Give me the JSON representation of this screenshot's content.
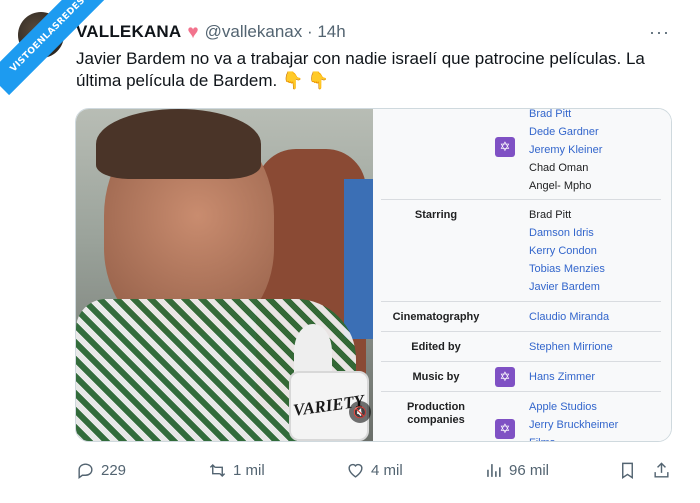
{
  "watermark": "VISTOENLASREDES",
  "tweet": {
    "author_name": "VALLEKANA",
    "handle_time": "@vallekanax · 14h",
    "more_icon": "more-dots-icon",
    "text_line1": "Javier Bardem no va a trabajar con nadie israelí que patrocine películas. La",
    "text_line2": "última película de Bardem. ",
    "emoji": "👇 👇"
  },
  "photo": {
    "mic_brand": "VARIETY",
    "mute_icon": "🔇"
  },
  "infobox": {
    "star_badge": "✡",
    "producers": [
      "Brad Pitt",
      "Dede Gardner",
      "Jeremy Kleiner",
      "Chad Oman",
      "Angel- Mpho"
    ],
    "starring_label": "Starring",
    "starring": [
      "Brad Pitt",
      "Damson Idris",
      "Kerry Condon",
      "Tobias Menzies",
      "Javier Bardem"
    ],
    "cinematography_label": "Cinematography",
    "cinematography": "Claudio Miranda",
    "edited_label": "Edited by",
    "edited": "Stephen Mirrione",
    "music_label": "Music by",
    "music": "Hans Zimmer",
    "production_label_1": "Production",
    "production_label_2": "companies",
    "production": [
      "Apple Studios",
      "Jerry Bruckheimer",
      "Films"
    ]
  },
  "actions": {
    "replies": "229",
    "retweets": "1 mil",
    "likes": "4 mil",
    "views": "96 mil"
  },
  "colors": {
    "link": "#3366cc",
    "badge": "#7f51c4",
    "accent": "#1d9bf0",
    "heart": "#f2738d"
  }
}
